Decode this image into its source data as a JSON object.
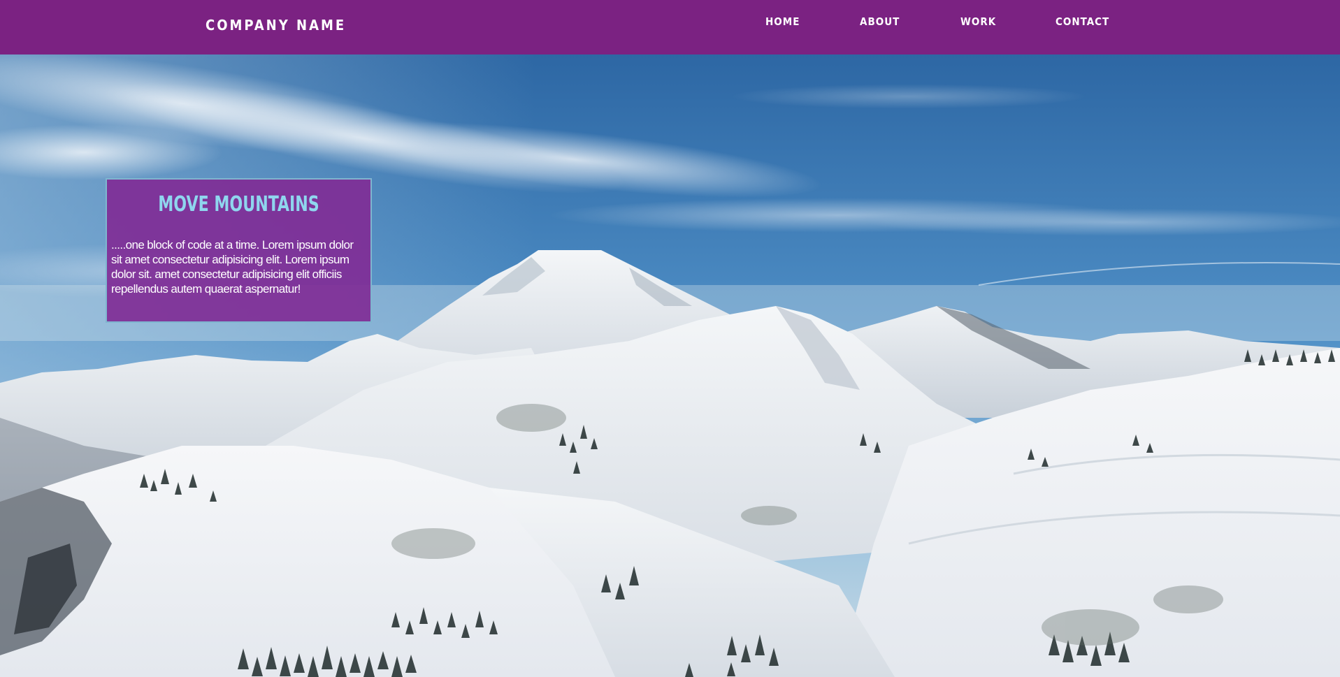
{
  "header": {
    "brand": "COMPANY NAME",
    "nav": {
      "home": "HOME",
      "about": "ABOUT",
      "work": "WORK",
      "contact": "CONTACT"
    }
  },
  "hero": {
    "card": {
      "title": "MOVE MOUNTAINS",
      "body": ".....one block of code at a time. Lorem ipsum dolor sit amet consectetur adipisicing elit. Lorem ipsum dolor sit. amet consectetur adipisicing elit officiis repellendus autem quaerat aspernatur!"
    }
  },
  "colors": {
    "navbar": "#7b2282",
    "card_background": "#802d96",
    "card_title": "#8fd6ee",
    "card_border": "#7fb6cf",
    "nav_text": "#ffffff"
  }
}
